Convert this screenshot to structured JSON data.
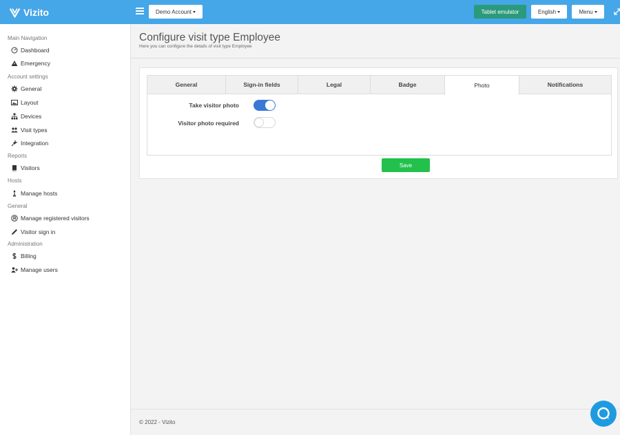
{
  "app": {
    "name": "Vizito"
  },
  "topbar": {
    "account_label": "Demo Account",
    "tablet_label": "Tablet emulator",
    "language_label": "English",
    "menu_label": "Menu"
  },
  "sidebar": {
    "sections": [
      {
        "title": "Main Navigation",
        "items": [
          {
            "label": "Dashboard",
            "icon": "dashboard-icon"
          },
          {
            "label": "Emergency",
            "icon": "warning-icon"
          }
        ]
      },
      {
        "title": "Account settings",
        "items": [
          {
            "label": "General",
            "icon": "gear-icon"
          },
          {
            "label": "Layout",
            "icon": "image-icon"
          },
          {
            "label": "Devices",
            "icon": "sitemap-icon"
          },
          {
            "label": "Visit types",
            "icon": "users-icon"
          },
          {
            "label": "Integration",
            "icon": "plug-icon"
          }
        ]
      },
      {
        "title": "Reports",
        "items": [
          {
            "label": "Visitors",
            "icon": "book-icon"
          }
        ]
      },
      {
        "title": "Hosts",
        "items": [
          {
            "label": "Manage hosts",
            "icon": "host-icon"
          }
        ]
      },
      {
        "title": "General",
        "items": [
          {
            "label": "Manage registered visitors",
            "icon": "registered-icon"
          },
          {
            "label": "Visitor sign in",
            "icon": "pencil-icon"
          }
        ]
      },
      {
        "title": "Administration",
        "items": [
          {
            "label": "Billing",
            "icon": "dollar-icon"
          },
          {
            "label": "Manage users",
            "icon": "user-plus-icon"
          }
        ]
      }
    ]
  },
  "header": {
    "title": "Configure visit type Employee",
    "subtitle": "Here you can configure the details of visit type Employee"
  },
  "tabs": [
    "General",
    "Sign-in fields",
    "Legal",
    "Badge",
    "Photo",
    "Notifications"
  ],
  "active_tab": "Photo",
  "form": {
    "take_photo_label": "Take visitor photo",
    "take_photo_on": true,
    "photo_required_label": "Visitor photo required",
    "photo_required_on": false,
    "save_label": "Save"
  },
  "footer": {
    "copyright": "© 2022 - Vizito"
  },
  "colors": {
    "topbar": "#45a6e8",
    "tablet_button": "#2b9a7a",
    "save_button": "#22c14c",
    "toggle_on": "#3a78d6",
    "chat": "#1e9be0"
  }
}
